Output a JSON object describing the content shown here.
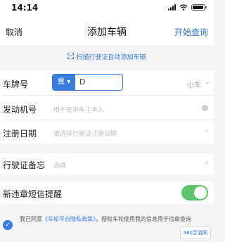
{
  "status_bar": {
    "time": "14:14"
  },
  "nav": {
    "cancel": "取消",
    "title": "添加车辆",
    "start_query": "开始查询"
  },
  "scan_link": "扫描行驶证自动添加车辆",
  "plate": {
    "label": "车牌号",
    "province": "冀 ▾",
    "value": "D",
    "car_type": "小车",
    "car_type_chevron": "⌄"
  },
  "engine": {
    "label": "发动机号",
    "placeholder": "用于查询车主本人"
  },
  "register_date": {
    "label": "注册日期",
    "placeholder": "请选择行驶证注册日期",
    "chevron": "›"
  },
  "memo": {
    "label": "行驶证备忘",
    "placeholder": "选填",
    "chevron": "›"
  },
  "sms": {
    "label": "新违章短信提醒",
    "enabled": true
  },
  "agreement": {
    "check": "✓",
    "prefix": "我已同意",
    "link": "《车轮平台隐私政策》",
    "suffix": "，授权车轮使用我的信息用于违章查询"
  },
  "watermark": "360手游网"
}
